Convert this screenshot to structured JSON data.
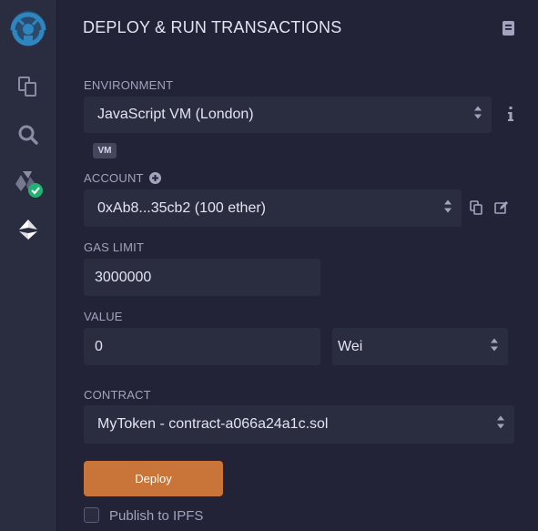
{
  "panel": {
    "title": "DEPLOY & RUN TRANSACTIONS"
  },
  "environment": {
    "label": "ENVIRONMENT",
    "value": "JavaScript VM (London)",
    "badge": "VM"
  },
  "account": {
    "label": "ACCOUNT",
    "value": "0xAb8...35cb2 (100 ether)"
  },
  "gas_limit": {
    "label": "GAS LIMIT",
    "value": "3000000"
  },
  "value": {
    "label": "VALUE",
    "amount": "0",
    "unit": "Wei"
  },
  "contract": {
    "label": "CONTRACT",
    "value": "MyToken - contract-a066a24a1c.sol"
  },
  "deploy": {
    "label": "Deploy"
  },
  "publish": {
    "label": "Publish to IPFS",
    "checked": false
  },
  "sidebar": {
    "icons": [
      "remix-logo-icon",
      "file-explorer-icon",
      "search-icon",
      "solidity-compiler-icon",
      "deploy-run-icon"
    ]
  },
  "colors": {
    "background": "#222336",
    "sidebar": "#2a2c3f",
    "field": "#2a2c3f",
    "accent": "#c97539",
    "success": "#1eb36f"
  }
}
